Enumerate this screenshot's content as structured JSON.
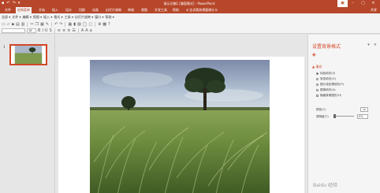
{
  "titlebar": {
    "title": "演示文稿1 [兼容模式] - PowerPoint",
    "qat_icons": [
      "save-icon",
      "undo-icon",
      "redo-icon",
      "customize-icon"
    ],
    "window_controls": [
      "restore-ribbon-icon",
      "minimize-icon",
      "maximize-icon",
      "close-icon"
    ]
  },
  "ribbon": {
    "tabs": [
      "文件",
      "经典菜单",
      "开始",
      "插入",
      "设计",
      "切换",
      "动画",
      "幻灯片放映",
      "审阅",
      "视图",
      "开发工具",
      "帮助"
    ],
    "active_tab_index": 1,
    "tell_me": "♀ 告诉我你想要做什么",
    "share": "共享"
  },
  "classic_menu": {
    "items": [
      "全部 ▾",
      "文件 ▾",
      "编辑 ▾",
      "视图 ▾",
      "插入 ▾",
      "格式 ▾",
      "工具 ▾",
      "幻灯片放映 ▾",
      "窗口 ▾",
      "帮助 ▾"
    ]
  },
  "toolbar": {
    "font_name": "",
    "font_size": "18"
  },
  "thumbnails": [
    {
      "number": "1"
    }
  ],
  "format_pane": {
    "title": "设置背景格式",
    "section": "▲ 填充",
    "options": [
      {
        "label": "纯色填充(S)",
        "type": "radio",
        "checked": true
      },
      {
        "label": "渐变填充(G)",
        "type": "radio",
        "checked": false
      },
      {
        "label": "图片或纹理填充(P)",
        "type": "radio",
        "checked": false
      },
      {
        "label": "图案填充(A)",
        "type": "radio",
        "checked": false
      },
      {
        "label": "隐藏背景图形(H)",
        "type": "check",
        "checked": false
      }
    ],
    "color_label": "颜色(C)",
    "transparency_label": "透明度(T)",
    "transparency_value": "0%"
  },
  "colors": {
    "brand": "#b7472a",
    "accent": "#d24726"
  },
  "watermark": "Baidu 经验"
}
